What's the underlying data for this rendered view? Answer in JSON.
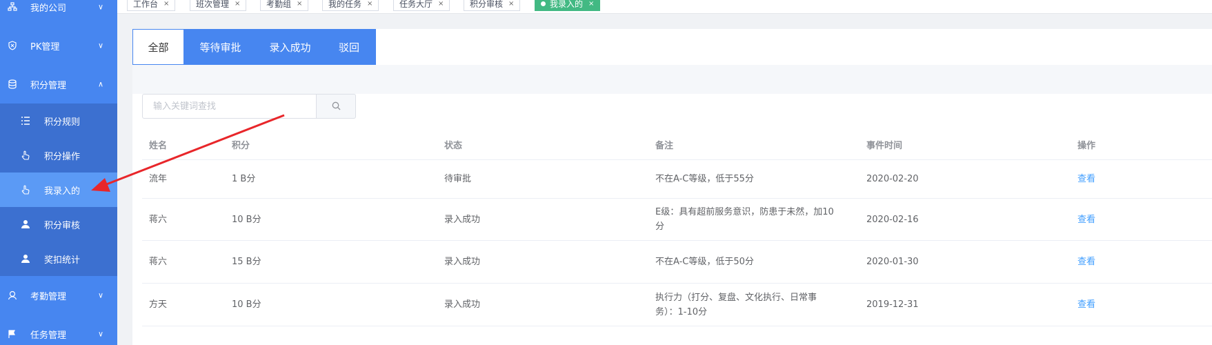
{
  "sidebar": {
    "items": [
      {
        "label": "我的公司",
        "icon": "org-icon",
        "chevron": "∨"
      },
      {
        "label": "PK管理",
        "icon": "pk-icon",
        "chevron": "∨"
      },
      {
        "label": "积分管理",
        "icon": "database-icon",
        "chevron": "∧"
      },
      {
        "label": "考勤管理",
        "icon": "attendance-icon",
        "chevron": "∨"
      },
      {
        "label": "任务管理",
        "icon": "flag-icon",
        "chevron": "∨"
      }
    ],
    "submenu": [
      {
        "label": "积分规则",
        "icon": "list-icon"
      },
      {
        "label": "积分操作",
        "icon": "hand-pointer-icon"
      },
      {
        "label": "我录入的",
        "icon": "hand-pointer-icon"
      },
      {
        "label": "积分审核",
        "icon": "user-icon"
      },
      {
        "label": "奖扣统计",
        "icon": "user-icon"
      }
    ]
  },
  "tags": [
    {
      "label": "工作台",
      "close": "×"
    },
    {
      "label": "班次管理",
      "close": "×"
    },
    {
      "label": "考勤组",
      "close": "×"
    },
    {
      "label": "我的任务",
      "close": "×"
    },
    {
      "label": "任务大厅",
      "close": "×"
    },
    {
      "label": "积分审核",
      "close": "×"
    },
    {
      "label": "我录入的",
      "close": "×"
    }
  ],
  "tabs": [
    "全部",
    "等待审批",
    "录入成功",
    "驳回"
  ],
  "search": {
    "placeholder": "输入关键词查找",
    "icon": "search-icon"
  },
  "table": {
    "headers": [
      "姓名",
      "积分",
      "状态",
      "备注",
      "事件时间",
      "操作"
    ],
    "rows": [
      {
        "name": "流年",
        "points": "1 B分",
        "status": "待审批",
        "note": "不在A-C等级，低于55分",
        "time": "2020-02-20",
        "action": "查看"
      },
      {
        "name": "蒋六",
        "points": "10 B分",
        "status": "录入成功",
        "note": "E级：具有超前服务意识，防患于未然，加10分",
        "time": "2020-02-16",
        "action": "查看"
      },
      {
        "name": "蒋六",
        "points": "15 B分",
        "status": "录入成功",
        "note": "不在A-C等级，低于50分",
        "time": "2020-01-30",
        "action": "查看"
      },
      {
        "name": "方天",
        "points": "10 B分",
        "status": "录入成功",
        "note": "执行力（打分、复盘、文化执行、日常事务）：1-10分",
        "time": "2019-12-31",
        "action": "查看"
      }
    ]
  },
  "colors": {
    "sidebar": "#4786f0",
    "submenu": "#3c70d0",
    "active_sub": "#5b9af5",
    "active_tag": "#42b983",
    "arrow": "#e8262a",
    "link": "#409eff"
  }
}
